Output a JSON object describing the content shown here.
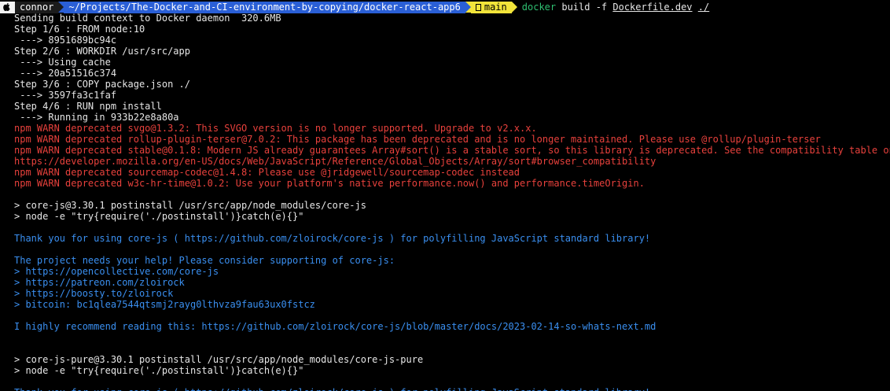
{
  "prompt": {
    "os_icon": "apple-icon",
    "user": "connor",
    "path": "~/Projects/The-Docker-and-CI-environment-by-copying/docker-react-app6",
    "git_icon": "git-branch-icon",
    "branch": "main",
    "command": {
      "program": "docker",
      "args": " build -f ",
      "file": "Dockerfile.dev",
      "space": " ",
      "context": "./"
    }
  },
  "colors": {
    "path_bg": "#2a5fd6",
    "git_bg": "#f2e43a",
    "warn": "#e8413c",
    "info": "#3a8ff0",
    "command": "#2fbf71"
  },
  "output": [
    {
      "text": "Sending build context to Docker daemon  320.6MB",
      "style": "white"
    },
    {
      "text": "Step 1/6 : FROM node:10",
      "style": "white"
    },
    {
      "text": " ---> 8951689bc94c",
      "style": "white"
    },
    {
      "text": "Step 2/6 : WORKDIR /usr/src/app",
      "style": "white"
    },
    {
      "text": " ---> Using cache",
      "style": "white"
    },
    {
      "text": " ---> 20a51516c374",
      "style": "white"
    },
    {
      "text": "Step 3/6 : COPY package.json ./",
      "style": "white"
    },
    {
      "text": " ---> 3597fa3c1faf",
      "style": "white"
    },
    {
      "text": "Step 4/6 : RUN npm install",
      "style": "white"
    },
    {
      "text": " ---> Running in 933b22e8a80a",
      "style": "white"
    },
    {
      "text": "npm WARN deprecated svgo@1.3.2: This SVGO version is no longer supported. Upgrade to v2.x.x.",
      "style": "red"
    },
    {
      "text": "npm WARN deprecated rollup-plugin-terser@7.0.2: This package has been deprecated and is no longer maintained. Please use @rollup/plugin-terser",
      "style": "red"
    },
    {
      "text": "npm WARN deprecated stable@0.1.8: Modern JS already guarantees Array#sort() is a stable sort, so this library is deprecated. See the compatibility table on MDN",
      "style": "red"
    },
    {
      "text": "https://developer.mozilla.org/en-US/docs/Web/JavaScript/Reference/Global_Objects/Array/sort#browser_compatibility",
      "style": "red"
    },
    {
      "text": "npm WARN deprecated sourcemap-codec@1.4.8: Please use @jridgewell/sourcemap-codec instead",
      "style": "red"
    },
    {
      "text": "npm WARN deprecated w3c-hr-time@1.0.2: Use your platform's native performance.now() and performance.timeOrigin.",
      "style": "red"
    },
    {
      "text": "",
      "style": "white"
    },
    {
      "text": "> core-js@3.30.1 postinstall /usr/src/app/node_modules/core-js",
      "style": "white"
    },
    {
      "text": "> node -e \"try{require('./postinstall')}catch(e){}\"",
      "style": "white"
    },
    {
      "text": "",
      "style": "white"
    },
    {
      "text": "Thank you for using core-js ( https://github.com/zloirock/core-js ) for polyfilling JavaScript standard library!",
      "style": "blue"
    },
    {
      "text": "",
      "style": "white"
    },
    {
      "text": "The project needs your help! Please consider supporting of core-js:",
      "style": "blue"
    },
    {
      "text": "> https://opencollective.com/core-js",
      "style": "blue"
    },
    {
      "text": "> https://patreon.com/zloirock",
      "style": "blue"
    },
    {
      "text": "> https://boosty.to/zloirock",
      "style": "blue"
    },
    {
      "text": "> bitcoin: bc1qlea7544qtsmj2rayg0lthvza9fau63ux0fstcz",
      "style": "blue"
    },
    {
      "text": "",
      "style": "white"
    },
    {
      "text": "I highly recommend reading this: https://github.com/zloirock/core-js/blob/master/docs/2023-02-14-so-whats-next.md",
      "style": "blue"
    },
    {
      "text": "",
      "style": "white"
    },
    {
      "text": "",
      "style": "white"
    },
    {
      "text": "> core-js-pure@3.30.1 postinstall /usr/src/app/node_modules/core-js-pure",
      "style": "white"
    },
    {
      "text": "> node -e \"try{require('./postinstall')}catch(e){}\"",
      "style": "white"
    },
    {
      "text": "",
      "style": "white"
    },
    {
      "text": "Thank you for using core-js ( https://github.com/zloirock/core-js ) for polyfilling JavaScript standard library!",
      "style": "blue"
    }
  ]
}
